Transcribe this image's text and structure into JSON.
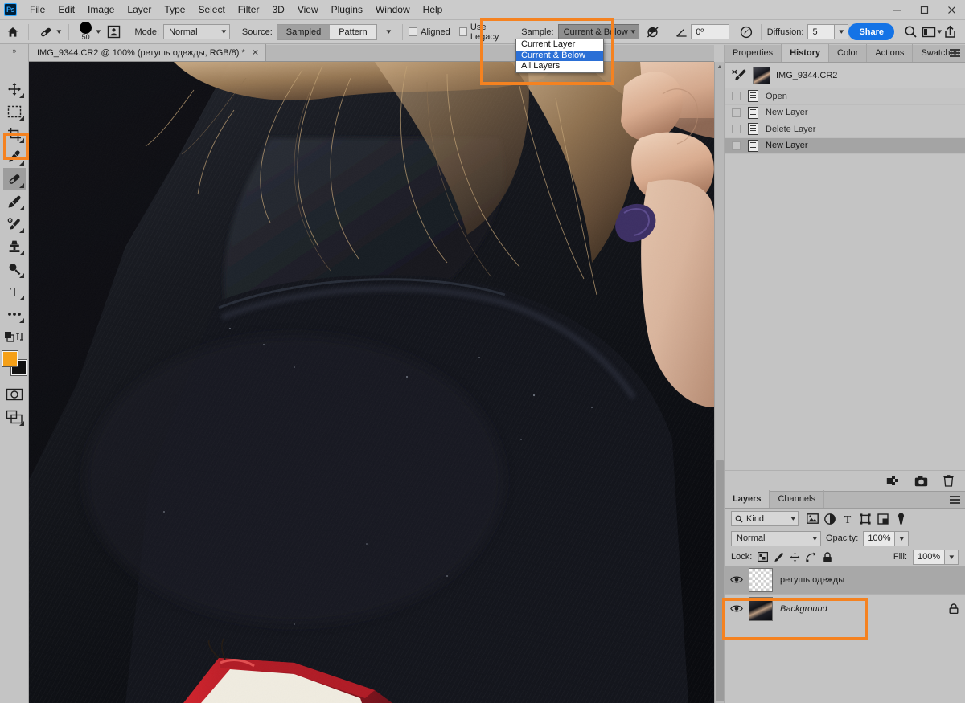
{
  "app": {
    "logo_text": "Ps",
    "title_menus": [
      "File",
      "Edit",
      "Image",
      "Layer",
      "Type",
      "Select",
      "Filter",
      "3D",
      "View",
      "Plugins",
      "Window",
      "Help"
    ],
    "window_controls": {
      "minimize": "—",
      "maximize": "□",
      "close": "✕"
    },
    "accent_highlight": "#f58220",
    "accent_blue": "#1473e6",
    "selection_blue": "#2a6fd6"
  },
  "options_bar": {
    "home_icon": "home-icon",
    "tool_preset_icon": "healing-brush-icon",
    "brush_size": "50",
    "brush_panel_icon": "brush-settings-icon",
    "mode_label": "Mode:",
    "mode_value": "Normal",
    "source_label": "Source:",
    "source_options": [
      "Sampled",
      "Pattern"
    ],
    "source_selected": "Sampled",
    "aligned_label": "Aligned",
    "aligned_checked": false,
    "use_legacy_label": "Use Legacy",
    "use_legacy_checked": false,
    "sample_label": "Sample:",
    "sample_value": "Current & Below",
    "ignore_adjustment_icon": "ignore-adjustment-layers-icon",
    "angle_icon": "angle-icon",
    "angle_value": "0º",
    "pressure_icon": "pressure-for-size-icon",
    "diffusion_label": "Diffusion:",
    "diffusion_value": "5",
    "share_label": "Share",
    "search_icon": "search-icon",
    "workspace_icon": "workspace-switcher-icon",
    "workspace_caret": "chevron-down-icon",
    "share_export_icon": "share-export-icon"
  },
  "sample_dropdown": {
    "open": true,
    "options": [
      "Current Layer",
      "Current & Below",
      "All Layers"
    ],
    "selected": "Current & Below"
  },
  "document": {
    "tab_title": "IMG_9344.CR2 @ 100% (ретушь одежды, RGB/8) *",
    "close_glyph": "✕"
  },
  "toolbar": {
    "collapse_glyph": "»",
    "tools": [
      {
        "name": "move-tool",
        "icon": "move-icon",
        "active": false,
        "has_flyout": true
      },
      {
        "name": "rectangular-marquee-tool",
        "icon": "marquee-icon",
        "active": false,
        "has_flyout": true
      },
      {
        "name": "crop-tool",
        "icon": "crop-icon",
        "active": false,
        "has_flyout": true
      },
      {
        "name": "eyedropper-tool",
        "icon": "eyedropper-icon",
        "active": false,
        "has_flyout": true
      },
      {
        "name": "healing-brush-tool",
        "icon": "healing-brush-icon",
        "active": true,
        "has_flyout": true
      },
      {
        "name": "brush-tool",
        "icon": "brush-icon",
        "active": false,
        "has_flyout": true
      },
      {
        "name": "history-brush-tool",
        "icon": "history-brush-icon",
        "active": false,
        "has_flyout": true
      },
      {
        "name": "clone-stamp-tool",
        "icon": "clone-stamp-icon",
        "active": false,
        "has_flyout": true
      },
      {
        "name": "dodge-tool",
        "icon": "dodge-icon",
        "active": false,
        "has_flyout": true
      },
      {
        "name": "type-tool",
        "icon": "type-icon",
        "active": false,
        "has_flyout": true
      },
      {
        "name": "edit-toolbar-tool",
        "icon": "ellipsis-icon",
        "active": false,
        "has_flyout": true
      }
    ],
    "swap_icon": "swap-colors-icon",
    "foreground_color": "#f5a018",
    "background_color": "#111111",
    "quick_mask_icon": "quick-mask-icon",
    "screen_mode_icon": "screen-mode-icon"
  },
  "canvas": {
    "zoom": "100%",
    "scrollbar": "vertical-scrollbar"
  },
  "panels": {
    "top_tabs": [
      "Properties",
      "History",
      "Color",
      "Actions",
      "Swatches"
    ],
    "top_active_tab": "History",
    "panel_menu_icon": "panel-menu-icon",
    "history": {
      "snapshot_name": "IMG_9344.CR2",
      "snapshot_icon": "history-snapshot-brush-icon",
      "states": [
        {
          "label": "Open",
          "selected": false
        },
        {
          "label": "New Layer",
          "selected": false
        },
        {
          "label": "Delete Layer",
          "selected": false
        },
        {
          "label": "New Layer",
          "selected": true
        }
      ],
      "footer_icons": [
        "create-document-from-state-icon",
        "create-snapshot-icon",
        "delete-state-icon"
      ]
    },
    "layers": {
      "tabs": [
        "Layers",
        "Channels"
      ],
      "active_tab": "Layers",
      "filter_icon": "search-icon",
      "filter_kind": "Kind",
      "filter_type_icons": [
        "pixel-layers-icon",
        "adjustment-layers-icon",
        "type-layers-icon",
        "shape-layers-icon",
        "smart-objects-icon",
        "toggle-filter-icon"
      ],
      "blend_mode": "Normal",
      "opacity_label": "Opacity:",
      "opacity_value": "100%",
      "lock_label": "Lock:",
      "lock_icons": [
        "lock-transparent-pixels-icon",
        "lock-image-pixels-icon",
        "lock-position-icon",
        "lock-artboard-nesting-icon",
        "lock-all-icon"
      ],
      "fill_label": "Fill:",
      "fill_value": "100%",
      "rows": [
        {
          "name": "ретушь одежды",
          "visible": true,
          "selected": true,
          "italic": false,
          "locked": false,
          "thumb": "transparent"
        },
        {
          "name": "Background",
          "visible": true,
          "selected": false,
          "italic": true,
          "locked": true,
          "thumb": "photo"
        }
      ]
    }
  },
  "annotations": [
    {
      "name": "sample-dropdown-highlight"
    },
    {
      "name": "healing-brush-tool-highlight"
    },
    {
      "name": "retouch-layer-highlight"
    }
  ]
}
